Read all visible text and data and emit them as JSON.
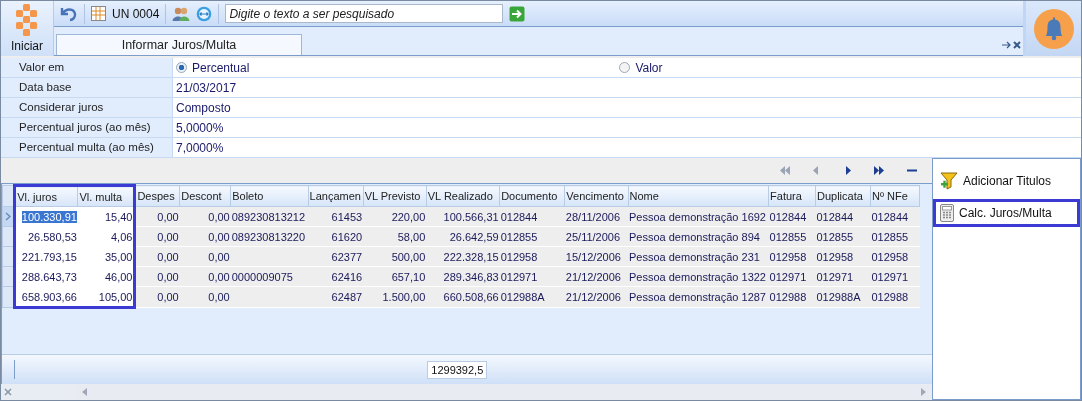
{
  "toolbar": {
    "unit": "UN 0004",
    "search": {
      "placeholder": "Digite o texto a ser pesquisado"
    }
  },
  "start_label": "Iniciar",
  "tabs": [
    {
      "label": "Informar Juros/Multa",
      "selected": true
    }
  ],
  "form": [
    {
      "label": "Valor em",
      "kind": "radio",
      "options": [
        {
          "label": "Percentual",
          "selected": true
        },
        {
          "label": "Valor",
          "selected": false
        }
      ]
    },
    {
      "label": "Data base",
      "kind": "text",
      "value": "21/03/2017"
    },
    {
      "label": "Considerar juros",
      "kind": "text",
      "value": "Composto"
    },
    {
      "label": "Percentual juros (ao mês)",
      "kind": "text",
      "value": "5,0000%"
    },
    {
      "label": "Percentual multa (ao mês)",
      "kind": "text",
      "value": "7,0000%"
    }
  ],
  "navigator": [
    {
      "kind": "first",
      "disabled": true
    },
    {
      "kind": "prev",
      "disabled": true
    },
    {
      "kind": "next",
      "disabled": false
    },
    {
      "kind": "last",
      "disabled": false
    },
    {
      "kind": "delete",
      "disabled": false
    }
  ],
  "table": {
    "columns": [
      {
        "label": "Vl. juros",
        "kind": "number",
        "highlighted": true
      },
      {
        "label": "Vl. multa",
        "kind": "number",
        "highlighted": true
      },
      {
        "label": "Despes",
        "kind": "number",
        "highlighted": false
      },
      {
        "label": "Descont",
        "kind": "number",
        "highlighted": false
      },
      {
        "label": "Boleto",
        "kind": "text",
        "highlighted": false
      },
      {
        "label": "Lançamen",
        "kind": "number",
        "highlighted": false
      },
      {
        "label": "VL Previsto",
        "kind": "number",
        "highlighted": false
      },
      {
        "label": "VL Realizado",
        "kind": "number",
        "highlighted": false,
        "total": "1299392,5"
      },
      {
        "label": "Documento",
        "kind": "text",
        "highlighted": false
      },
      {
        "label": "Vencimento",
        "kind": "text",
        "highlighted": false
      },
      {
        "label": "Nome",
        "kind": "text",
        "highlighted": false
      },
      {
        "label": "Fatura",
        "kind": "text",
        "highlighted": false
      },
      {
        "label": "Duplicata",
        "kind": "text",
        "highlighted": false
      },
      {
        "label": "Nº NFe",
        "kind": "text",
        "highlighted": false
      }
    ],
    "rows": [
      {
        "selected": true,
        "cells": [
          "100.330,91",
          "15,40",
          "0,00",
          "0,00",
          "089230813212",
          "61453",
          "220,00",
          "100.566,31",
          "012844",
          "28/11/2006",
          "Pessoa demonstração 1692",
          "012844",
          "012844",
          "012844"
        ]
      },
      {
        "selected": false,
        "cells": [
          "26.580,53",
          "4,06",
          "0,00",
          "0,00",
          "089230813220",
          "61620",
          "58,00",
          "26.642,59",
          "012855",
          "25/11/2006",
          "Pessoa demonstração 894",
          "012855",
          "012855",
          "012855"
        ]
      },
      {
        "selected": false,
        "cells": [
          "221.793,15",
          "35,00",
          "0,00",
          "0,00",
          "",
          "62377",
          "500,00",
          "222.328,15",
          "012958",
          "15/12/2006",
          "Pessoa demonstração 231",
          "012958",
          "012958",
          "012958"
        ]
      },
      {
        "selected": false,
        "cells": [
          "288.643,73",
          "46,00",
          "0,00",
          "0,00",
          "0000009075",
          "62416",
          "657,10",
          "289.346,83",
          "012971",
          "21/12/2006",
          "Pessoa demonstração 1322",
          "012971",
          "012971",
          "012971"
        ]
      },
      {
        "selected": false,
        "cells": [
          "658.903,66",
          "105,00",
          "0,00",
          "0,00",
          "",
          "62487",
          "1.500,00",
          "660.508,66",
          "012988A",
          "21/12/2006",
          "Pessoa demonstração 1287",
          "012988",
          "012988A",
          "012988"
        ]
      }
    ]
  },
  "actions": [
    {
      "label": "Adicionar Titulos",
      "kind": "add-filter",
      "highlighted": false
    },
    {
      "label": "Calc. Juros/Multa",
      "kind": "calculator",
      "highlighted": true
    }
  ]
}
